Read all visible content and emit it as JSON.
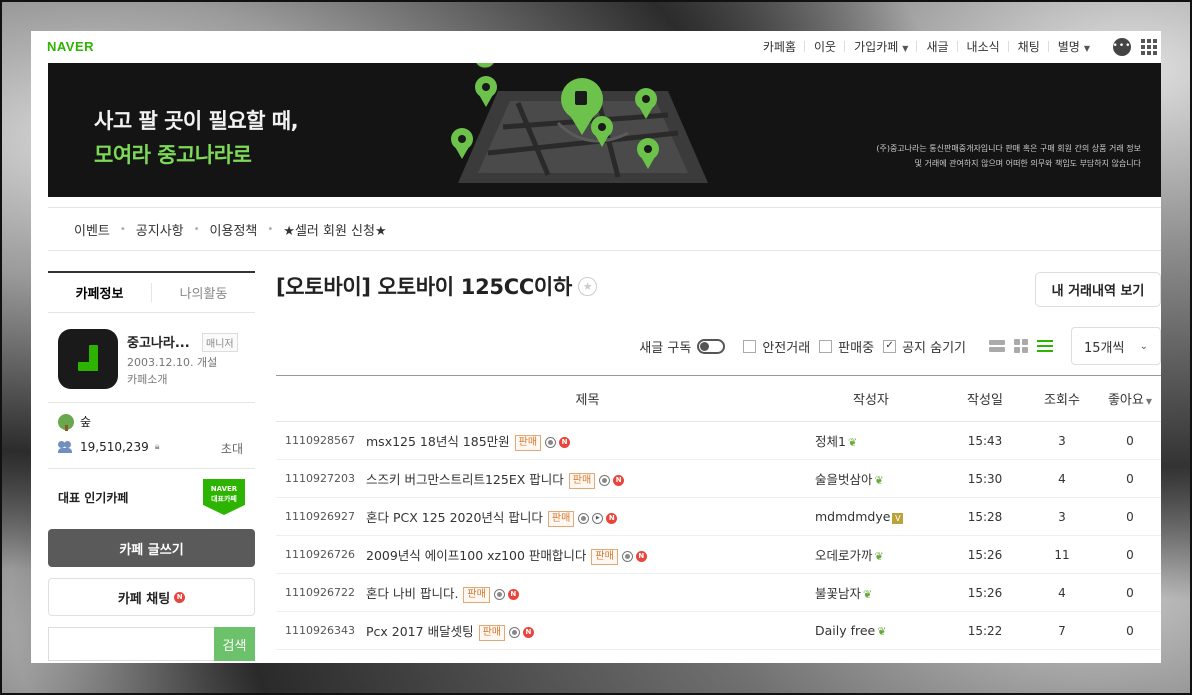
{
  "gnb": {
    "logo": "NAVER",
    "items": [
      {
        "label": "카페홈"
      },
      {
        "label": "이웃"
      },
      {
        "label": "가입카페"
      },
      {
        "label": "새글"
      },
      {
        "label": "내소식"
      },
      {
        "label": "채팅"
      },
      {
        "label": "별명"
      }
    ]
  },
  "banner": {
    "line1": "사고 팔 곳이 필요할 때,",
    "line2": "모여라 중고나라로",
    "notice1": "(주)중고나라는 통신판매중개자입니다 판매 혹은 구매 회원 간의 상품 거래 정보",
    "notice2": "및 거래에 관여하지 않으며 어떠한 의무와 책임도 부담하지 않습니다",
    "accent": "#7ed957"
  },
  "submenu": {
    "items": [
      "이벤트",
      "공지사항",
      "이용정책",
      "★셀러 회원 신청★"
    ]
  },
  "sidebar": {
    "tabs": [
      "카페정보",
      "나의활동"
    ],
    "cafe": {
      "name": "중고나라...",
      "manager": "매니저",
      "founded": "2003.12.10. 개설",
      "intro": "카페소개"
    },
    "level": "숲",
    "members": "19,510,239",
    "invite": "초대",
    "popular_label": "대표 인기카페",
    "naver_badge_1": "NAVER",
    "naver_badge_2": "대표카페",
    "write_button": "카페 글쓰기",
    "chat_button": "카페 채팅",
    "search_button": "검색",
    "search_value": ""
  },
  "board": {
    "title": "[오토바이] 오토바이 125CC이하",
    "history_button": "내 거래내역 보기",
    "filters": {
      "new_sub": "새글 구독",
      "safe_trade": "안전거래",
      "on_sale": "판매중",
      "hide_notice": "공지 숨기기",
      "hide_notice_checked": true,
      "per_page": "15개씩"
    },
    "columns": [
      "제목",
      "작성자",
      "작성일",
      "조회수",
      "좋아요"
    ],
    "sale_tag": "판매",
    "rows": [
      {
        "id": "1110928567",
        "title": "msx125 18년식 185만원",
        "author": "정체1",
        "time": "15:43",
        "views": "3",
        "likes": "0",
        "play": false,
        "badge": "sprout"
      },
      {
        "id": "1110927203",
        "title": "스즈키 버그만스트리트125EX 팝니다",
        "author": "술을벗삼아",
        "time": "15:30",
        "views": "4",
        "likes": "0",
        "play": false,
        "badge": "sprout"
      },
      {
        "id": "1110926927",
        "title": "혼다 PCX 125 2020년식 팝니다",
        "author": "mdmdmdye",
        "time": "15:28",
        "views": "3",
        "likes": "0",
        "play": true,
        "badge": "v"
      },
      {
        "id": "1110926726",
        "title": "2009년식 에이프100 xz100 판매합니다",
        "author": "오데로가까",
        "time": "15:26",
        "views": "11",
        "likes": "0",
        "play": false,
        "badge": "sprout"
      },
      {
        "id": "1110926722",
        "title": "혼다 나비 팝니다.",
        "author": "불꽃남자",
        "time": "15:26",
        "views": "4",
        "likes": "0",
        "play": false,
        "badge": "sprout"
      },
      {
        "id": "1110926343",
        "title": "Pcx 2017 배달셋팅",
        "author": "Daily free",
        "time": "15:22",
        "views": "7",
        "likes": "0",
        "play": false,
        "badge": "sprout"
      }
    ]
  }
}
